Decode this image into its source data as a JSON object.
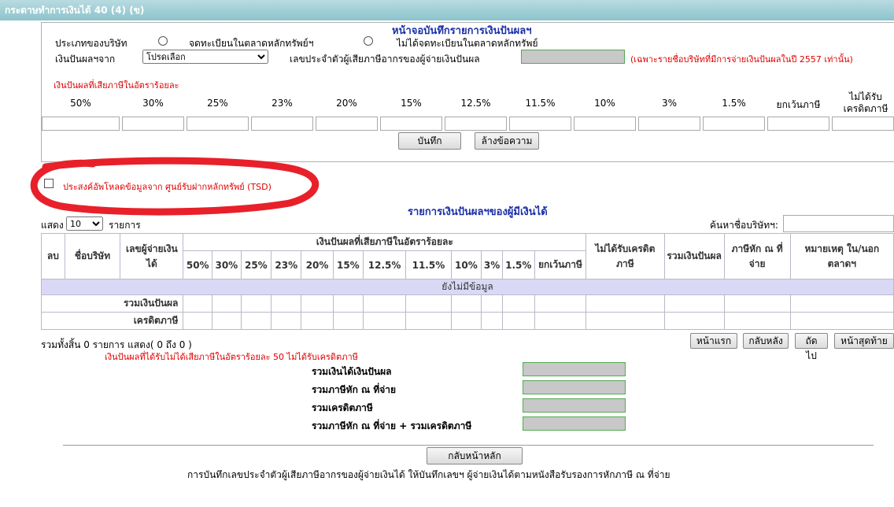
{
  "window_title": "กระดาษทำการเงินได้ 40 (4) (ข)",
  "form": {
    "heading": "หน้าจอบันทึกรายการเงินปันผลฯ",
    "company_type_label": "ประเภทของบริษัท",
    "radio_listed": "จดทะเบียนในตลาดหลักทรัพย์ฯ",
    "radio_unlisted": "ไม่ได้จดทะเบียนในตลาดหลักทรัพย์",
    "dividend_from_label": "เงินปันผลฯจาก",
    "dividend_from_value": "โปรดเลือก",
    "payer_tax_id_label": "เลขประจำตัวผู้เสียภาษีอากรของผู้จ่ายเงินปันผล",
    "payer_note": "(เฉพาะรายชื่อบริษัทที่มีการจ่ายเงินปันผลในปี 2557 เท่านั้น)",
    "rate_heading": "เงินปันผลที่เสียภาษีในอัตราร้อยละ",
    "rates": [
      "50%",
      "30%",
      "25%",
      "23%",
      "20%",
      "15%",
      "12.5%",
      "11.5%",
      "10%",
      "3%",
      "1.5%",
      "ยกเว้นภาษี",
      "ไม่ได้รับเครดิตภาษี"
    ],
    "save_button": "บันทึก",
    "clear_button": "ล้างข้อความ"
  },
  "tsd": {
    "checkbox_label": "ประสงค์อัพโหลดข้อมูลจาก ศูนย์รับฝากหลักทรัพย์ (TSD)"
  },
  "list": {
    "heading": "รายการเงินปันผลฯของผู้มีเงินได้",
    "show_label": "แสดง",
    "page_size": "10",
    "items_label": "รายการ",
    "search_label": "ค้นหาชื่อบริษัทฯ:",
    "search_value": "",
    "headers": {
      "delete": "ลบ",
      "company_name": "ชื่อบริษัท",
      "payer_id": "เลขผู้จ่ายเงินได้",
      "taxed_group": "เงินปันผลที่เสียภาษีในอัตราร้อยละ",
      "rates": [
        "50%",
        "30%",
        "25%",
        "23%",
        "20%",
        "15%",
        "12.5%",
        "11.5%",
        "10%",
        "3%",
        "1.5%",
        "ยกเว้นภาษี"
      ],
      "no_credit": "ไม่ได้รับเครดิตภาษี",
      "total_dividend": "รวมเงินปันผล",
      "withheld": "ภาษีหัก ณ ที่จ่าย",
      "remark": "หมายเหตุ ใน/นอกตลาดฯ"
    },
    "no_data": "ยังไม่มีข้อมูล",
    "sum_dividend_row": "รวมเงินปันผล",
    "tax_credit_row": "เครดิตภาษี",
    "summary_text": "รวมทั้งสิ้น 0 รายการ แสดง( 0 ถึง 0 )",
    "pager": [
      "หน้าแรก",
      "กลับหลัง",
      "ถัดไป",
      "หน้าสุดท้าย"
    ],
    "note": "เงินปันผลที่ได้รับไม่ได้เสียภาษีในอัตราร้อยละ 50 ไม่ได้รับเครดิตภาษี"
  },
  "totals": {
    "total_income": "รวมเงินได้เงินปันผล",
    "total_withheld": "รวมภาษีหัก ณ ที่จ่าย",
    "total_credit": "รวมเครดิตภาษี",
    "total_withheld_plus_credit": "รวมภาษีหัก ณ ที่จ่าย + รวมเครดิตภาษี"
  },
  "back_button": "กลับหน้าหลัก",
  "footer_note": "การบันทึกเลขประจำตัวผู้เสียภาษีอากรของผู้จ่ายเงินได้ ให้บันทึกเลขฯ ผู้จ่ายเงินได้ตามหนังสือรับรองการหักภาษี ณ ที่จ่าย"
}
